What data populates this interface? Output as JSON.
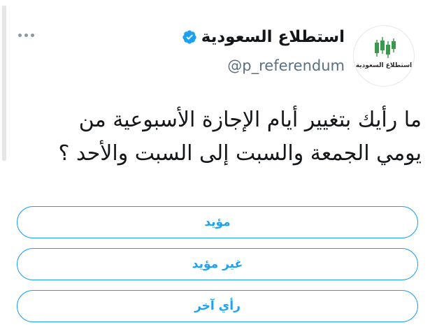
{
  "tweet": {
    "author": {
      "display_name": "استطلاع السعودية",
      "handle": "@p_referendum",
      "verified": true,
      "avatar_text": "استطلاع السعودية",
      "avatar_icon": "candlestick-chart-icon"
    },
    "text_line1": "ما رأيك بتغيير أيام الإجازة الأسبوعية من",
    "text_line2": "يومي الجمعة والسبت إلى السبت والأحد ؟",
    "more_icon": "more-horizontal-icon",
    "poll": {
      "options": [
        {
          "label": "مؤيد"
        },
        {
          "label": "غير مؤيد"
        },
        {
          "label": "رأي آخر"
        }
      ]
    }
  },
  "colors": {
    "accent": "#1da1f2",
    "verified": "#1da1f2",
    "text": "#14171a",
    "secondary": "#5b7083",
    "avatar_green": "#3a9a4b"
  }
}
